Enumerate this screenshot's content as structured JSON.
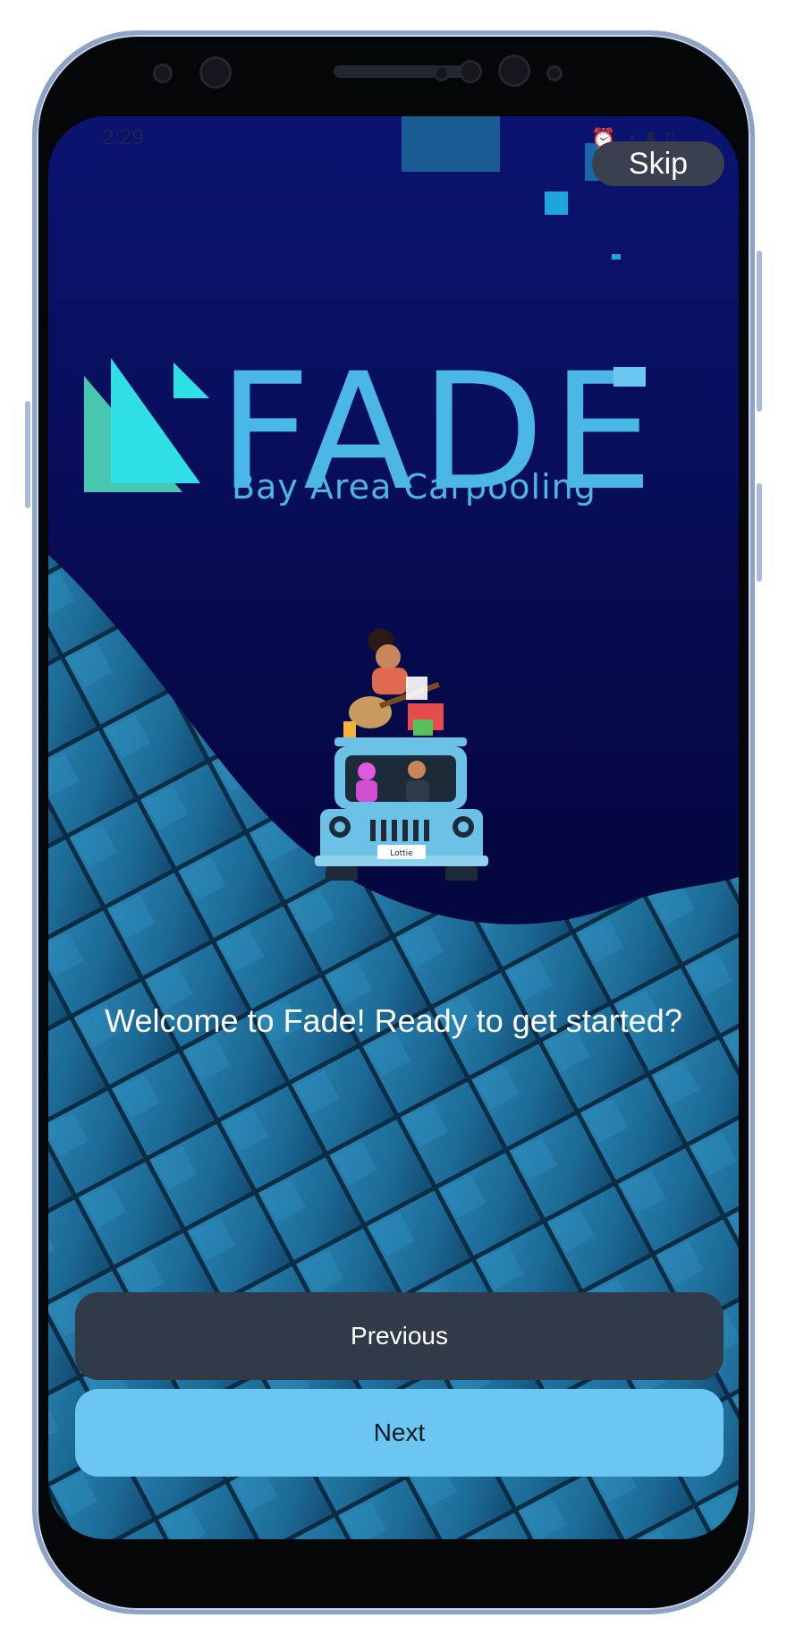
{
  "status_bar": {
    "time": "2:29",
    "icons": [
      "alarm-icon",
      "wifi-icon",
      "signal-icon",
      "battery-icon"
    ]
  },
  "header": {
    "skip_label": "Skip"
  },
  "logo": {
    "wordmark": "FADE",
    "subtitle": "Bay Area Carpooling"
  },
  "illustration": {
    "plate_text": "Lottie"
  },
  "main": {
    "welcome_text": "Welcome to Fade! Ready to get started?"
  },
  "navigation": {
    "previous_label": "Previous",
    "next_label": "Next"
  },
  "colors": {
    "background_dark": "#06063f",
    "tiles": "#1e6f9c",
    "brand_blue": "#4ab7e6",
    "brand_teal": "#2ee0e6",
    "previous_button": "#313a48",
    "next_button": "#6bc7f2",
    "skip_button": "#3a404f"
  }
}
